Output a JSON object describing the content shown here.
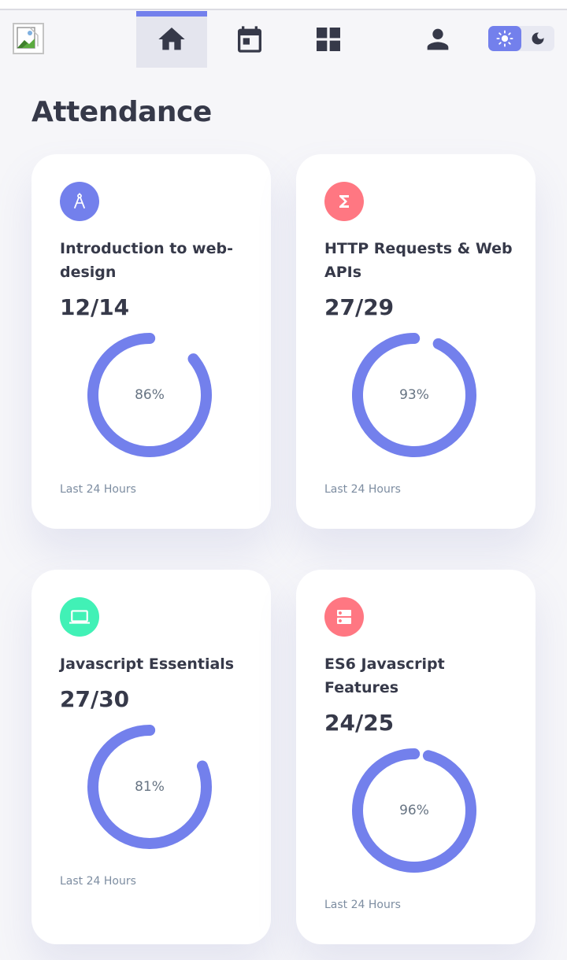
{
  "nav": {
    "items": [
      {
        "name": "home",
        "icon": "home-icon",
        "active": true
      },
      {
        "name": "calendar",
        "icon": "calendar-icon",
        "active": false
      },
      {
        "name": "dashboard",
        "icon": "grid-icon",
        "active": false
      },
      {
        "name": "profile",
        "icon": "person-icon",
        "active": false
      }
    ],
    "theme": {
      "options": [
        "light-mode-icon",
        "dark-mode-icon"
      ],
      "selected": "light"
    }
  },
  "page": {
    "title": "Attendance"
  },
  "colors": {
    "accent": "#7380ec",
    "purple_icon": "#7380ec",
    "red_icon": "#ff7782",
    "green_icon": "#41f1b6",
    "text_dark": "#363949",
    "text_muted": "#7d8da1"
  },
  "cards": [
    {
      "title": "Introduction to web-design",
      "ratio": "12/14",
      "percent_label": "86%",
      "percent": 0.86,
      "footer": "Last 24 Hours",
      "icon": "architecture-icon",
      "icon_color": "#7380ec"
    },
    {
      "title": "HTTP Requests & Web APIs",
      "ratio": "27/29",
      "percent_label": "93%",
      "percent": 0.93,
      "footer": "Last 24 Hours",
      "icon": "functions-icon",
      "icon_color": "#ff7782"
    },
    {
      "title": "Javascript Essentials",
      "ratio": "27/30",
      "percent_label": "81%",
      "percent": 0.81,
      "footer": "Last 24 Hours",
      "icon": "computer-icon",
      "icon_color": "#41f1b6"
    },
    {
      "title": "ES6 Javascript Features",
      "ratio": "24/25",
      "percent_label": "96%",
      "percent": 0.96,
      "footer": "Last 24 Hours",
      "icon": "dns-icon",
      "icon_color": "#ff7782"
    }
  ]
}
